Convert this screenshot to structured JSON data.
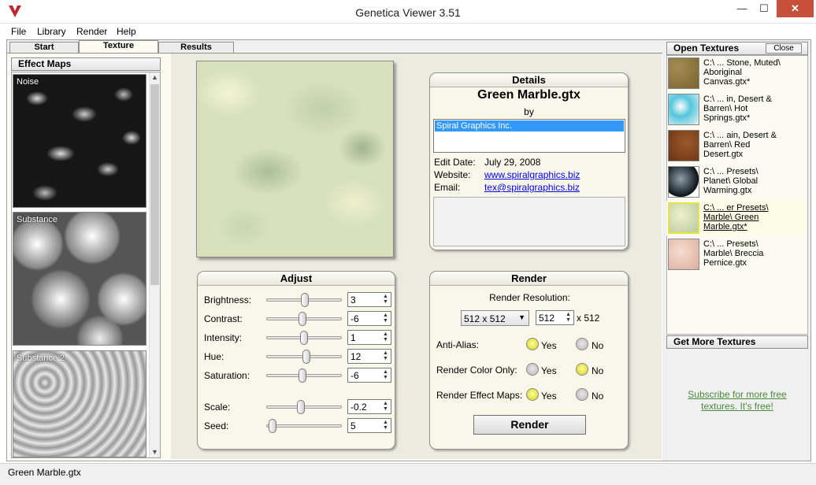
{
  "window": {
    "title": "Genetica Viewer 3.51",
    "minimize": "—",
    "maximize": "☐",
    "close": "✕"
  },
  "menu": [
    "File",
    "Library",
    "Render",
    "Help"
  ],
  "tabs": [
    "Start",
    "Texture",
    "Results"
  ],
  "effect_maps": {
    "header": "Effect Maps",
    "items": [
      "Noise",
      "Substance",
      "Substance 2"
    ]
  },
  "details": {
    "title": "Details",
    "name": "Green Marble.gtx",
    "by": "by",
    "author": "Spiral Graphics Inc.",
    "edit_date_label": "Edit Date:",
    "edit_date": "July 29, 2008",
    "website_label": "Website:",
    "website": "www.spiralgraphics.biz",
    "email_label": "Email:",
    "email": "tex@spiralgraphics.biz"
  },
  "adjust": {
    "title": "Adjust",
    "params": [
      {
        "label": "Brightness:",
        "value": "3"
      },
      {
        "label": "Contrast:",
        "value": "-6"
      },
      {
        "label": "Intensity:",
        "value": "1"
      },
      {
        "label": "Hue:",
        "value": "12"
      },
      {
        "label": "Saturation:",
        "value": "-6"
      },
      {
        "label": "Scale:",
        "value": "-0.2"
      },
      {
        "label": "Seed:",
        "value": "5"
      }
    ]
  },
  "render": {
    "title": "Render",
    "resolution_label": "Render Resolution:",
    "resolution_select": "512 x 512",
    "resolution_width": "512",
    "resolution_suffix": "x 512",
    "anti_alias_label": "Anti-Alias:",
    "color_only_label": "Render Color Only:",
    "effect_maps_label": "Render Effect Maps:",
    "yes": "Yes",
    "no": "No",
    "anti_alias": "Yes",
    "color_only": "No",
    "effect_maps": "Yes",
    "button": "Render"
  },
  "open_textures": {
    "header": "Open Textures",
    "close": "Close",
    "items": [
      {
        "lines": [
          "C:\\ ... Stone, Muted\\",
          "Aboriginal",
          "Canvas.gtx*"
        ]
      },
      {
        "lines": [
          "C:\\ ... in, Desert &",
          "Barren\\ Hot",
          "Springs.gtx*"
        ]
      },
      {
        "lines": [
          "C:\\ ... ain, Desert &",
          "Barren\\ Red",
          "Desert.gtx"
        ]
      },
      {
        "lines": [
          "C:\\ ... Presets\\",
          "Planet\\ Global",
          "Warming.gtx"
        ]
      },
      {
        "lines": [
          "C:\\ ... er Presets\\",
          "Marble\\ Green",
          "Marble.gtx*"
        ]
      },
      {
        "lines": [
          "C:\\ ... Presets\\",
          "Marble\\ Breccia",
          "Pernice.gtx"
        ]
      }
    ]
  },
  "get_more": {
    "header": "Get More Textures",
    "link_line1": "Subscribe for more free",
    "link_line2": "textures.  It's free!"
  },
  "status": "Green Marble.gtx"
}
